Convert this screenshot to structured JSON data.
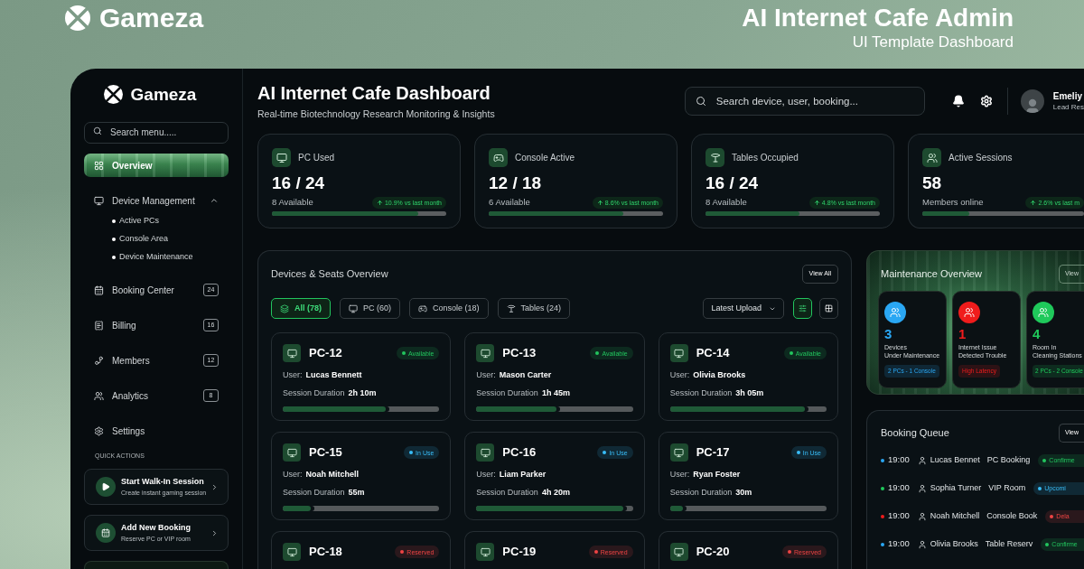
{
  "promo": {
    "brand": "Gameza",
    "title": "AI Internet Cafe Admin",
    "subtitle": "UI Template Dashboard"
  },
  "sidebar": {
    "brand": "Gameza",
    "search": {
      "placeholder": "Search menu....."
    },
    "items": [
      {
        "label": "Overview",
        "selected": true
      },
      {
        "label": "Device Management",
        "selected": false,
        "expanded": true,
        "children": [
          {
            "label": "Active PCs"
          },
          {
            "label": "Console Area"
          },
          {
            "label": "Device Maintenance"
          }
        ]
      },
      {
        "label": "Booking Center",
        "selected": false,
        "count": "24"
      },
      {
        "label": "Billing",
        "selected": false,
        "count": "16"
      },
      {
        "label": "Members",
        "selected": false,
        "count": "12"
      },
      {
        "label": "Analytics",
        "selected": false,
        "count": "8"
      },
      {
        "label": "Settings",
        "selected": false
      }
    ],
    "quick_actions_title": "QUICK ACTIONS",
    "quick_actions": [
      {
        "title": "Start Walk-In Session",
        "subtitle": "Create instant gaming session"
      },
      {
        "title": "Add New Booking",
        "subtitle": "Reserve PC or VIP room"
      }
    ]
  },
  "header": {
    "title": "AI Internet Cafe Dashboard",
    "subtitle": "Real-time Biotechnology Research Monitoring & Insights",
    "search": {
      "placeholder": "Search device, user, booking..."
    },
    "user": {
      "name": "Emeliy",
      "role": "Lead Res"
    }
  },
  "stats": [
    {
      "label": "PC Used",
      "value": "16 / 24",
      "sub": "8 Available",
      "trend": "10.9% vs last month",
      "level": 0.84
    },
    {
      "label": "Console Active",
      "value": "12 / 18",
      "sub": "6 Available",
      "trend": "8.6% vs last month",
      "level": 0.77
    },
    {
      "label": "Tables Occupied",
      "value": "16 / 24",
      "sub": "8 Available",
      "trend": "4.8% vs last month",
      "level": 0.54
    },
    {
      "label": "Active Sessions",
      "value": "58",
      "sub": "Members online",
      "trend": "2.6% vs last m",
      "level": 0.29
    }
  ],
  "devices": {
    "title": "Devices & Seats Overview",
    "view_all": "View All",
    "filters": [
      {
        "label": "All (78)",
        "selected": true
      },
      {
        "label": "PC (60)",
        "selected": false
      },
      {
        "label": "Console (18)",
        "selected": false
      },
      {
        "label": "Tables (24)",
        "selected": false
      }
    ],
    "sort": "Latest Upload",
    "view_modes": [
      {
        "kind": "list",
        "selected": true
      },
      {
        "kind": "grid",
        "selected": false
      }
    ],
    "cards": [
      {
        "name": "PC-12",
        "status": {
          "label": "Available",
          "color": "#22c55e"
        },
        "user_label": "User:",
        "user": "Lucas Bennett",
        "duration_label": "Session Duration",
        "duration": "2h 10m",
        "level": 0.66
      },
      {
        "name": "PC-13",
        "status": {
          "label": "Available",
          "color": "#22c55e"
        },
        "user_label": "User:",
        "user": "Mason Carter",
        "duration_label": "Session Duration",
        "duration": "1h 45m",
        "level": 0.51
      },
      {
        "name": "PC-14",
        "status": {
          "label": "Available",
          "color": "#22c55e"
        },
        "user_label": "User:",
        "user": "Olivia Brooks",
        "duration_label": "Session Duration",
        "duration": "3h 05m",
        "level": 0.86
      },
      {
        "name": "PC-15",
        "status": {
          "label": "In Use",
          "color": "#38bdf8"
        },
        "user_label": "User:",
        "user": "Noah Mitchell",
        "duration_label": "Session Duration",
        "duration": "55m",
        "level": 0.18
      },
      {
        "name": "PC-16",
        "status": {
          "label": "In Use",
          "color": "#38bdf8"
        },
        "user_label": "User:",
        "user": "Liam Parker",
        "duration_label": "Session Duration",
        "duration": "4h 20m",
        "level": 0.94
      },
      {
        "name": "PC-17",
        "status": {
          "label": "In Use",
          "color": "#38bdf8"
        },
        "user_label": "User:",
        "user": "Ryan Foster",
        "duration_label": "Session Duration",
        "duration": "30m",
        "level": 0.08
      },
      {
        "name": "PC-18",
        "status": {
          "label": "Reserved",
          "color": "#ef4444"
        }
      },
      {
        "name": "PC-19",
        "status": {
          "label": "Reserved",
          "color": "#ef4444"
        }
      },
      {
        "name": "PC-20",
        "status": {
          "label": "Reserved",
          "color": "#ef4444"
        }
      }
    ]
  },
  "maintenance": {
    "title": "Maintenance Overview",
    "view_all": "View",
    "cards": [
      {
        "value": "3",
        "label": "Devices\nUnder Maintenance",
        "tag": "2 PCs - 1 Console",
        "color": "#2aa7f3"
      },
      {
        "value": "1",
        "label": "Internet Issue\nDetected Trouble",
        "tag": "High Latency",
        "color": "#f01c1c"
      },
      {
        "value": "4",
        "label": "Room In\nCleaning Stations",
        "tag": "2 PCs - 2 Console",
        "color": "#1fc95b"
      }
    ]
  },
  "booking_queue": {
    "title": "Booking Queue",
    "view_all": "View",
    "rows": [
      {
        "time": "19:00",
        "name": "Lucas Bennet",
        "type": "PC Booking",
        "color": "#2aa7f3",
        "status": {
          "label": "Confirme",
          "color": "#22c55e"
        }
      },
      {
        "time": "19:00",
        "name": "Sophia Turner",
        "type": "VIP Room",
        "color": "#1fc95b",
        "status": {
          "label": "Upcomi",
          "color": "#38bdf8"
        }
      },
      {
        "time": "19:00",
        "name": "Noah Mitchell",
        "type": "Console Book",
        "color": "#f01c1c",
        "status": {
          "label": "Dela",
          "color": "#ef4444"
        }
      },
      {
        "time": "19:00",
        "name": "Olivia Brooks",
        "type": "Table Reserv",
        "color": "#2aa7f3",
        "status": {
          "label": "Confirme",
          "color": "#22c55e"
        }
      }
    ]
  }
}
